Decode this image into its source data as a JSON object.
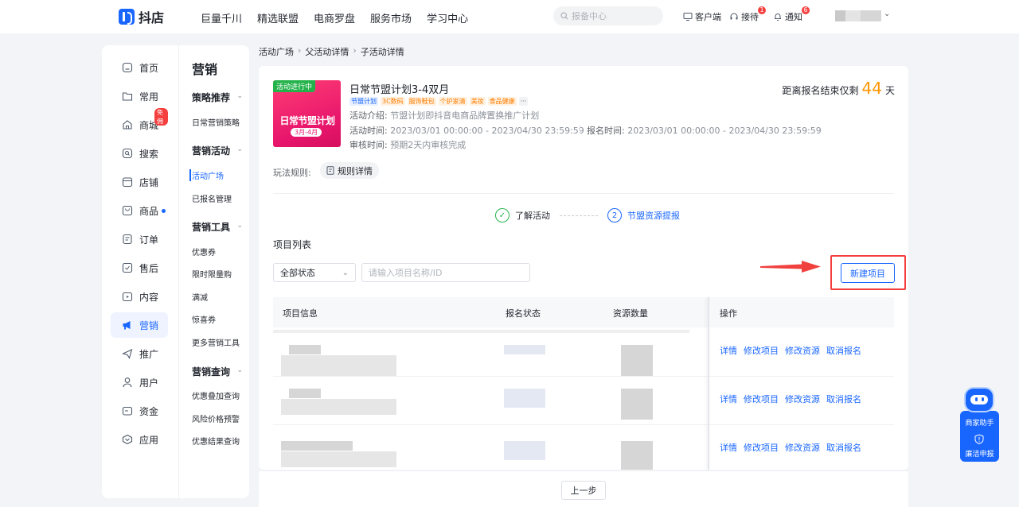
{
  "brand": {
    "name": "抖店"
  },
  "topnav": [
    "巨量千川",
    "精选联盟",
    "电商罗盘",
    "服务市场",
    "学习中心"
  ],
  "search": {
    "placeholder": "报备中心"
  },
  "tools": {
    "client": "客户端",
    "reception": "接待",
    "reception_badge": "1",
    "notice": "通知",
    "notice_badge": "6"
  },
  "sidebar": [
    {
      "label": "首页",
      "icon": "home-icon"
    },
    {
      "label": "常用",
      "icon": "star-folder-icon"
    },
    {
      "label": "商城",
      "icon": "shop-icon",
      "badge": "免佣"
    },
    {
      "label": "搜索",
      "icon": "search-icon"
    },
    {
      "label": "店铺",
      "icon": "store-icon"
    },
    {
      "label": "商品",
      "icon": "goods-icon",
      "dot": true
    },
    {
      "label": "订单",
      "icon": "order-icon"
    },
    {
      "label": "售后",
      "icon": "after-sale-icon"
    },
    {
      "label": "内容",
      "icon": "content-icon"
    },
    {
      "label": "营销",
      "icon": "megaphone-icon",
      "active": true
    },
    {
      "label": "推广",
      "icon": "promotion-icon"
    },
    {
      "label": "用户",
      "icon": "user-icon"
    },
    {
      "label": "资金",
      "icon": "wallet-icon"
    },
    {
      "label": "应用",
      "icon": "app-icon"
    }
  ],
  "submenu": {
    "title": "营销",
    "groups": [
      {
        "label": "策略推荐",
        "items": [
          "日常营销策略"
        ]
      },
      {
        "label": "营销活动",
        "items": [
          "活动广场",
          "已报名管理"
        ]
      },
      {
        "label": "营销工具",
        "items": [
          "优惠券",
          "限时限量购",
          "满减",
          "惊喜券",
          "更多营销工具"
        ]
      },
      {
        "label": "营销查询",
        "items": [
          "优惠叠加查询",
          "风险价格预警",
          "优惠结果查询"
        ]
      }
    ]
  },
  "breadcrumb": [
    "活动广场",
    "父活动详情",
    "子活动详情"
  ],
  "activity": {
    "status_tag": "活动进行中",
    "banner_title": "日常节盟计划",
    "banner_sub": "3月-4月",
    "title": "日常节盟计划3-4双月",
    "tags": [
      "节盟计划",
      "3C数码",
      "服饰鞋包",
      "个护家清",
      "美妆",
      "食品健康",
      "···"
    ],
    "intro_label": "活动介绍:",
    "intro": "节盟计划即抖音电商品牌置换推广计划",
    "time_label": "活动时间:",
    "time": "2023/03/01 00:00:00 - 2023/04/30 23:59:59",
    "signup_label": "报名时间:",
    "signup": "2023/03/01 00:00:00 - 2023/04/30 23:59:59",
    "review_label": "审核时间:",
    "review": "预期2天内审核完成",
    "countdown_prefix": "距离报名结束仅剩",
    "countdown_days": "44",
    "countdown_unit": "天",
    "rule_label": "玩法规则:",
    "rule_button": "规则详情"
  },
  "steps": [
    {
      "label": "了解活动",
      "state": "done"
    },
    {
      "label": "节盟资源提报",
      "index": "2",
      "state": "current"
    }
  ],
  "project_list": {
    "title": "项目列表",
    "filter_value": "全部状态",
    "search_placeholder": "请输入项目名称/ID",
    "new_button": "新建项目",
    "columns": [
      "项目信息",
      "报名状态",
      "资源数量",
      "操作"
    ],
    "row_actions": [
      "详情",
      "修改项目",
      "修改资源",
      "取消报名"
    ],
    "row_count": 3
  },
  "footer": {
    "prev_button": "上一步"
  },
  "assistant": {
    "label": "商家助手",
    "report": "廉洁申报"
  },
  "colors": {
    "primary": "#1966ff",
    "danger": "#f53f3f",
    "success": "#24b34b",
    "warning": "#ff9500"
  }
}
